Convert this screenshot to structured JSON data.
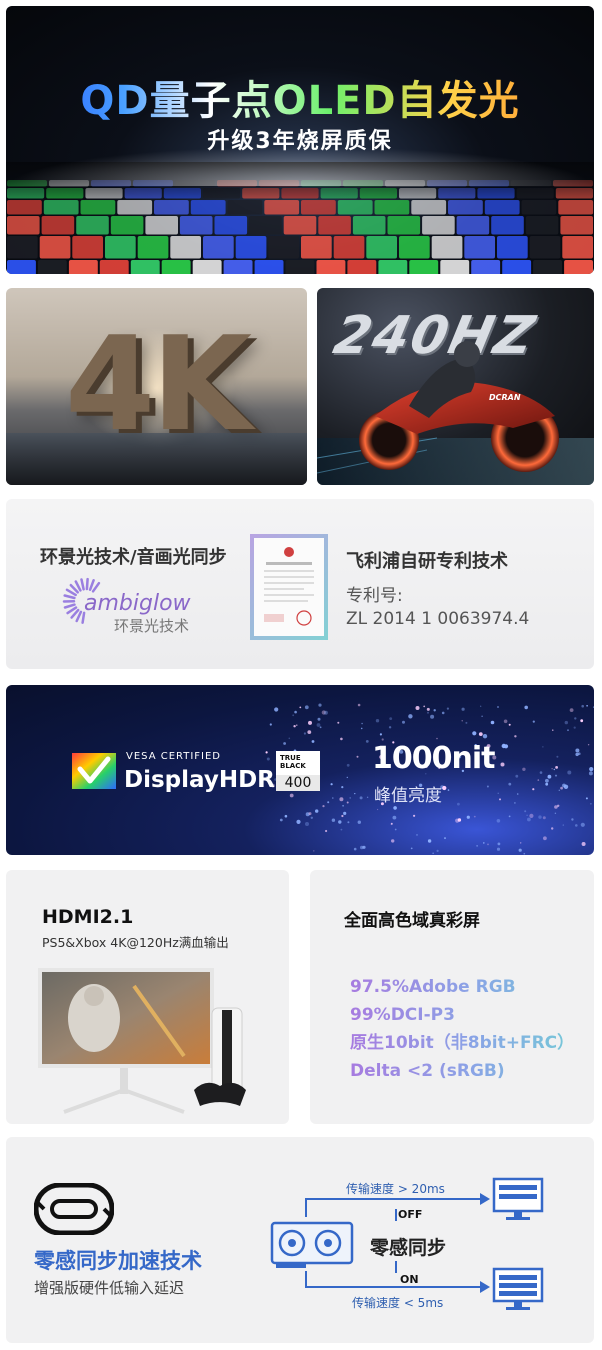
{
  "hero": {
    "title": "QD量子点OLED自发光",
    "subtitle": "升级3年烧屏质保"
  },
  "resolution": {
    "label": "4K"
  },
  "refresh": {
    "label": "240HZ"
  },
  "ambiglow": {
    "heading": "环景光技术/音画光同步",
    "logo_word": "ambiglow",
    "logo_cn": "环景光技术",
    "patent_heading": "飞利浦自研专利技术",
    "patent_label": "专利号:",
    "patent_number": "ZL 2014 1 0063974.4"
  },
  "hdr": {
    "vesa_certified": "VESA CERTIFIED",
    "display_hdr": "DisplayHDR™",
    "badge_top": "TRUE BLACK",
    "badge_num": "400",
    "brightness": "1000nit",
    "brightness_sub": "峰值亮度"
  },
  "hdmi": {
    "heading": "HDMI2.1",
    "sub": "PS5&Xbox 4K@120Hz满血输出"
  },
  "color": {
    "heading": "全面高色域真彩屏",
    "specs": [
      "97.5%Adobe RGB",
      "99%DCI-P3",
      "原生10bit（非8bit+FRC）",
      "Delta <2 (sRGB)"
    ]
  },
  "sync": {
    "title": "零感同步加速技术",
    "subtitle": "增强版硬件低输入延迟",
    "top_speed": "传输速度 > 20ms",
    "off": "OFF",
    "center": "零感同步",
    "on": "ON",
    "bottom_speed": "传输速度 < 5ms"
  },
  "colors": {
    "sync_blue": "#3568c8",
    "gamut_gradient_start": "#a77be0",
    "gamut_gradient_end": "#75c9d8",
    "hdr_bg": "#14215e"
  }
}
